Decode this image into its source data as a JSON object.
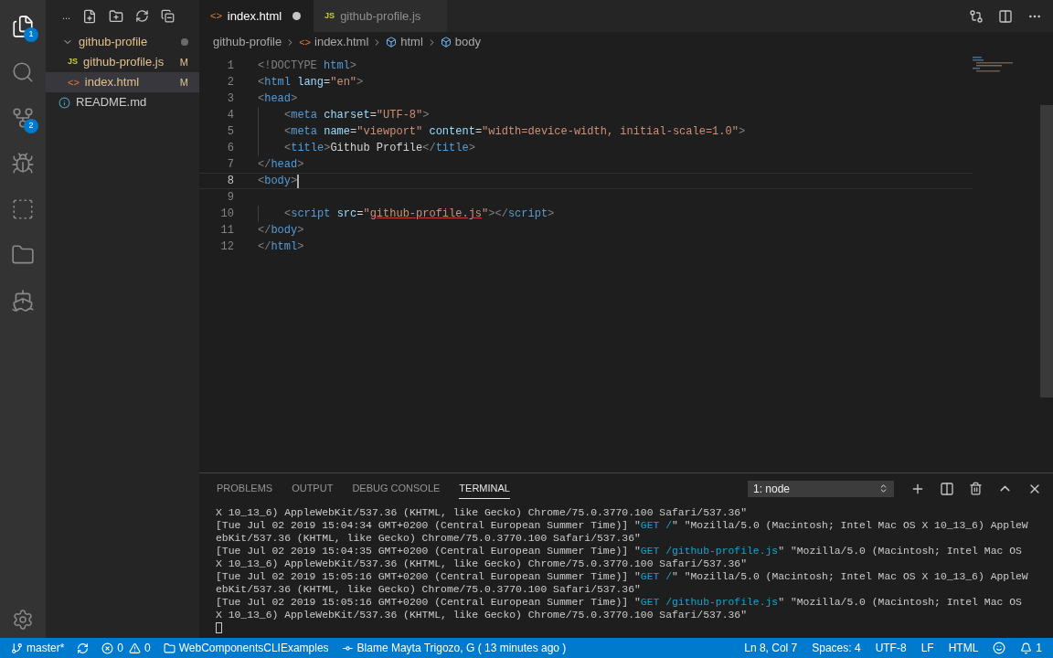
{
  "activity_bar": {
    "items": [
      {
        "kind": "files",
        "selected": true,
        "badge": "1"
      },
      {
        "kind": "search",
        "selected": false
      },
      {
        "kind": "scm",
        "selected": false,
        "badge": "2"
      },
      {
        "kind": "debug",
        "selected": false
      },
      {
        "kind": "extensions",
        "selected": false
      },
      {
        "kind": "folder",
        "selected": false
      },
      {
        "kind": "docker",
        "selected": false
      }
    ]
  },
  "explorer": {
    "more": "...",
    "folder": {
      "name": "github-profile",
      "expanded": true,
      "modified": true,
      "children": [
        {
          "name": "github-profile.js",
          "icon": "JS",
          "kind": "js",
          "badge": "M",
          "selected": false
        },
        {
          "name": "index.html",
          "icon": "<>",
          "kind": "html",
          "badge": "M",
          "selected": true
        }
      ]
    },
    "root_files": [
      {
        "name": "README.md",
        "kind": "info"
      }
    ]
  },
  "tabs": [
    {
      "label": "index.html",
      "icon": "<>",
      "kind": "html",
      "selected": true,
      "dirty": true
    },
    {
      "label": "github-profile.js",
      "icon": "JS",
      "kind": "js",
      "selected": false,
      "dirty": false
    }
  ],
  "breadcrumbs": [
    {
      "label": "github-profile",
      "kind": "folder"
    },
    {
      "label": "index.html",
      "kind": "file",
      "icon": "<>"
    },
    {
      "label": "html",
      "kind": "element"
    },
    {
      "label": "body",
      "kind": "element"
    }
  ],
  "editor": {
    "lines": [
      {
        "number": "1",
        "current": false,
        "indented": false,
        "tokens": [
          {
            "kind": "punct",
            "text": "<!DOCTYPE "
          },
          {
            "kind": "tag",
            "text": "html"
          },
          {
            "kind": "punct",
            "text": ">"
          }
        ]
      },
      {
        "number": "2",
        "current": false,
        "indented": false,
        "tokens": [
          {
            "kind": "punct",
            "text": "<"
          },
          {
            "kind": "tag",
            "text": "html "
          },
          {
            "kind": "attr",
            "text": "lang"
          },
          {
            "kind": "plain",
            "text": "="
          },
          {
            "kind": "string",
            "text": "\"en\""
          },
          {
            "kind": "punct",
            "text": ">"
          }
        ]
      },
      {
        "number": "3",
        "current": false,
        "indented": false,
        "tokens": [
          {
            "kind": "punct",
            "text": "<"
          },
          {
            "kind": "tag",
            "text": "head"
          },
          {
            "kind": "punct",
            "text": ">"
          }
        ]
      },
      {
        "number": "4",
        "current": false,
        "indented": true,
        "tokens": [
          {
            "kind": "punct",
            "text": "<"
          },
          {
            "kind": "tag",
            "text": "meta "
          },
          {
            "kind": "attr",
            "text": "charset"
          },
          {
            "kind": "plain",
            "text": "="
          },
          {
            "kind": "string",
            "text": "\"UTF-8\""
          },
          {
            "kind": "punct",
            "text": ">"
          }
        ]
      },
      {
        "number": "5",
        "current": false,
        "indented": true,
        "tokens": [
          {
            "kind": "punct",
            "text": "<"
          },
          {
            "kind": "tag",
            "text": "meta "
          },
          {
            "kind": "attr",
            "text": "name"
          },
          {
            "kind": "plain",
            "text": "="
          },
          {
            "kind": "string",
            "text": "\"viewport\" "
          },
          {
            "kind": "attr",
            "text": "content"
          },
          {
            "kind": "plain",
            "text": "="
          },
          {
            "kind": "string",
            "text": "\"width=device-width, initial-scale=1.0\""
          },
          {
            "kind": "punct",
            "text": ">"
          }
        ]
      },
      {
        "number": "6",
        "current": false,
        "indented": true,
        "tokens": [
          {
            "kind": "punct",
            "text": "<"
          },
          {
            "kind": "tag",
            "text": "title"
          },
          {
            "kind": "punct",
            "text": ">"
          },
          {
            "kind": "plain",
            "text": "Github Profile"
          },
          {
            "kind": "punct",
            "text": "</"
          },
          {
            "kind": "tag",
            "text": "title"
          },
          {
            "kind": "punct",
            "text": ">"
          }
        ]
      },
      {
        "number": "7",
        "current": false,
        "indented": false,
        "tokens": [
          {
            "kind": "punct",
            "text": "</"
          },
          {
            "kind": "tag",
            "text": "head"
          },
          {
            "kind": "punct",
            "text": ">"
          }
        ]
      },
      {
        "number": "8",
        "current": true,
        "indented": false,
        "tokens": [
          {
            "kind": "punct",
            "text": "<"
          },
          {
            "kind": "tag",
            "text": "body"
          },
          {
            "kind": "punct",
            "text": ">"
          }
        ]
      },
      {
        "number": "9",
        "current": false,
        "indented": false
      },
      {
        "number": "10",
        "current": false,
        "indented": true,
        "tokens": [
          {
            "kind": "punct",
            "text": "<"
          },
          {
            "kind": "tag",
            "text": "script "
          },
          {
            "kind": "attr",
            "text": "src"
          },
          {
            "kind": "plain",
            "text": "="
          },
          {
            "kind": "string",
            "text": "\""
          },
          {
            "kind": "link",
            "text": "github-profile.js"
          },
          {
            "kind": "string",
            "text": "\""
          },
          {
            "kind": "punct",
            "text": "></"
          },
          {
            "kind": "tag",
            "text": "script"
          },
          {
            "kind": "punct",
            "text": ">"
          }
        ]
      },
      {
        "number": "11",
        "current": false,
        "indented": false,
        "tokens": [
          {
            "kind": "punct",
            "text": "</"
          },
          {
            "kind": "tag",
            "text": "body"
          },
          {
            "kind": "punct",
            "text": ">"
          }
        ]
      },
      {
        "number": "12",
        "current": false,
        "indented": false,
        "tokens": [
          {
            "kind": "punct",
            "text": "</"
          },
          {
            "kind": "tag",
            "text": "html"
          },
          {
            "kind": "punct",
            "text": ">"
          }
        ]
      }
    ]
  },
  "panel": {
    "tabs": [
      {
        "label": "PROBLEMS",
        "selected": false
      },
      {
        "label": "OUTPUT",
        "selected": false
      },
      {
        "label": "DEBUG CONSOLE",
        "selected": false
      },
      {
        "label": "TERMINAL",
        "selected": true
      }
    ],
    "terminal_select": "1: node",
    "terminal_lines": [
      [
        {
          "kind": "plain",
          "text": "X 10_13_6) AppleWebKit/537.36 (KHTML, like Gecko) Chrome/75.0.3770.100 Safari/537.36\""
        }
      ],
      [
        {
          "kind": "plain",
          "text": "[Tue Jul 02 2019 15:04:34 GMT+0200 (Central European Summer Time)] \""
        },
        {
          "kind": "request",
          "text": "GET /"
        },
        {
          "kind": "plain",
          "text": "\" \"Mozilla/5.0 (Macintosh; Intel Mac OS X 10_13_6) AppleW"
        }
      ],
      [
        {
          "kind": "plain",
          "text": "ebKit/537.36 (KHTML, like Gecko) Chrome/75.0.3770.100 Safari/537.36\""
        }
      ],
      [
        {
          "kind": "plain",
          "text": "[Tue Jul 02 2019 15:04:35 GMT+0200 (Central European Summer Time)] \""
        },
        {
          "kind": "request",
          "text": "GET /github-profile.js"
        },
        {
          "kind": "plain",
          "text": "\" \"Mozilla/5.0 (Macintosh; Intel Mac OS"
        }
      ],
      [
        {
          "kind": "plain",
          "text": "X 10_13_6) AppleWebKit/537.36 (KHTML, like Gecko) Chrome/75.0.3770.100 Safari/537.36\""
        }
      ],
      [
        {
          "kind": "plain",
          "text": "[Tue Jul 02 2019 15:05:16 GMT+0200 (Central European Summer Time)] \""
        },
        {
          "kind": "request",
          "text": "GET /"
        },
        {
          "kind": "plain",
          "text": "\" \"Mozilla/5.0 (Macintosh; Intel Mac OS X 10_13_6) AppleW"
        }
      ],
      [
        {
          "kind": "plain",
          "text": "ebKit/537.36 (KHTML, like Gecko) Chrome/75.0.3770.100 Safari/537.36\""
        }
      ],
      [
        {
          "kind": "plain",
          "text": "[Tue Jul 02 2019 15:05:16 GMT+0200 (Central European Summer Time)] \""
        },
        {
          "kind": "request",
          "text": "GET /github-profile.js"
        },
        {
          "kind": "plain",
          "text": "\" \"Mozilla/5.0 (Macintosh; Intel Mac OS"
        }
      ],
      [
        {
          "kind": "plain",
          "text": "X 10_13_6) AppleWebKit/537.36 (KHTML, like Gecko) Chrome/75.0.3770.100 Safari/537.36\""
        }
      ]
    ]
  },
  "status_bar": {
    "left": [
      {
        "kind": "branch",
        "label": "master*"
      },
      {
        "kind": "sync"
      },
      {
        "kind": "errors",
        "label": "0"
      },
      {
        "kind": "warnings",
        "label": "0"
      },
      {
        "kind": "folder",
        "label": "WebComponentsCLIExamples"
      },
      {
        "kind": "blame",
        "label": "Blame Mayta Trigozo, G ( 13 minutes ago )"
      }
    ],
    "right": [
      {
        "kind": "text",
        "label": "Ln 8, Col 7"
      },
      {
        "kind": "text",
        "label": "Spaces: 4"
      },
      {
        "kind": "text",
        "label": "UTF-8"
      },
      {
        "kind": "text",
        "label": "LF"
      },
      {
        "kind": "text",
        "label": "HTML"
      },
      {
        "kind": "feedback"
      },
      {
        "kind": "bell",
        "label": "1"
      }
    ]
  }
}
